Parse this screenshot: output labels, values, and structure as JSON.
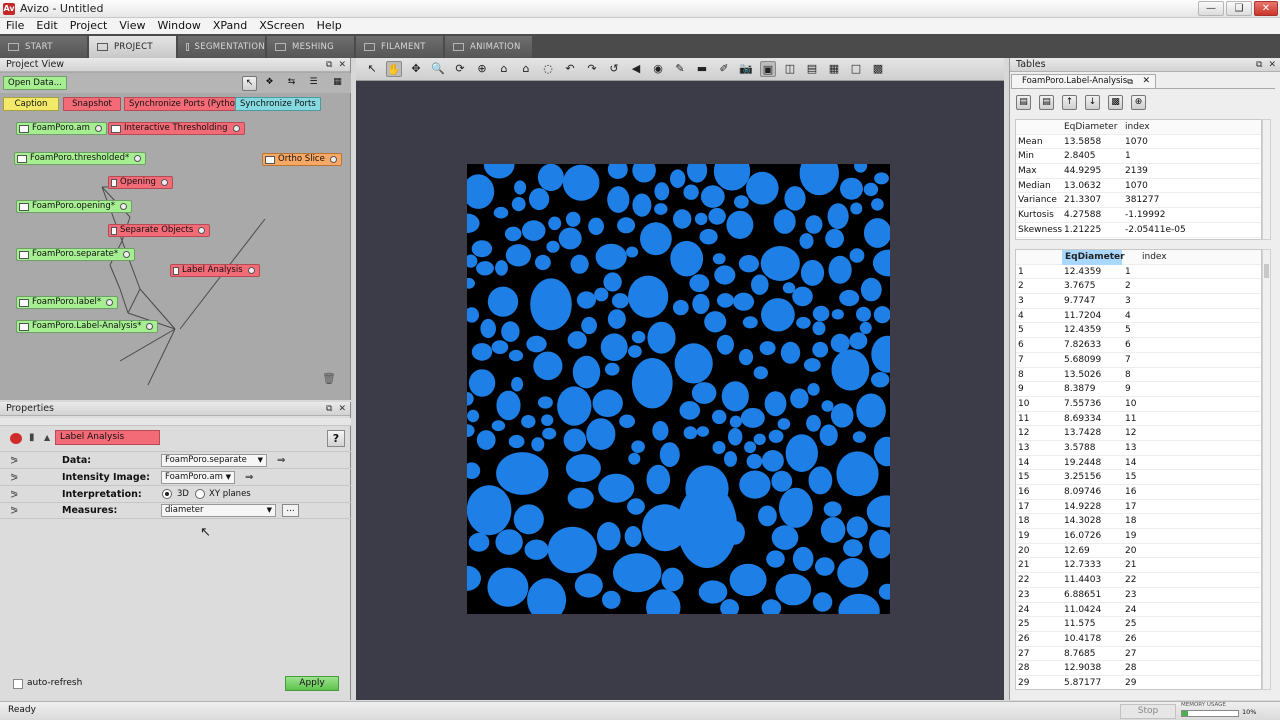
{
  "window": {
    "title": "Avizo - Untitled",
    "logo": "Av"
  },
  "menu": [
    "File",
    "Edit",
    "Project",
    "View",
    "Window",
    "XPand",
    "XScreen",
    "Help"
  ],
  "tabs": [
    {
      "label": "START",
      "active": false
    },
    {
      "label": "PROJECT",
      "active": true
    },
    {
      "label": "SEGMENTATION",
      "active": false
    },
    {
      "label": "MESHING",
      "active": false
    },
    {
      "label": "FILAMENT",
      "active": false
    },
    {
      "label": "ANIMATION",
      "active": false
    }
  ],
  "project_view": {
    "title": "Project View",
    "open_data": "Open Data...",
    "buttons": [
      "Caption",
      "Snapshot",
      "Synchronize Ports (Python)",
      "Synchronize Ports"
    ],
    "nodes": {
      "foamporo_am": "FoamPoro.am",
      "interactive_thresholding": "Interactive Thresholding",
      "foamporo_thresholded": "FoamPoro.thresholded*",
      "ortho_slice": "Ortho Slice",
      "opening": "Opening",
      "foamporo_opening": "FoamPoro.opening*",
      "separate_objects": "Separate Objects",
      "foamporo_separate": "FoamPoro.separate*",
      "label_analysis": "Label Analysis",
      "foamporo_label": "FoamPoro.label*",
      "foamporo_label_analysis": "FoamPoro.Label-Analysis*"
    }
  },
  "properties": {
    "title": "Properties",
    "module": "Label Analysis",
    "help": "?",
    "rows": {
      "data": {
        "label": "Data:",
        "value": "FoamPoro.separate"
      },
      "intensity": {
        "label": "Intensity Image:",
        "value": "FoamPoro.am"
      },
      "interpretation": {
        "label": "Interpretation:",
        "opt1": "3D",
        "opt2": "XY planes"
      },
      "measures": {
        "label": "Measures:",
        "value": "diameter",
        "more": "..."
      }
    },
    "auto_refresh": "auto-refresh",
    "apply": "Apply"
  },
  "tables": {
    "title": "Tables",
    "tab": "FoamPoro.Label-Analysis",
    "stats_headers": [
      "",
      "EqDiameter",
      "index"
    ],
    "stats": [
      [
        "Mean",
        "13.5858",
        "1070"
      ],
      [
        "Min",
        "2.8405",
        "1"
      ],
      [
        "Max",
        "44.9295",
        "2139"
      ],
      [
        "Median",
        "13.0632",
        "1070"
      ],
      [
        "Variance",
        "21.3307",
        "381277"
      ],
      [
        "Kurtosis",
        "4.27588",
        "-1.19992"
      ],
      [
        "Skewness",
        "1.21225",
        "-2.05411e-05"
      ]
    ],
    "data_headers": [
      "",
      "EqDiameter",
      "index"
    ],
    "rows": [
      [
        "1",
        "12.4359",
        "1"
      ],
      [
        "2",
        "3.7675",
        "2"
      ],
      [
        "3",
        "9.7747",
        "3"
      ],
      [
        "4",
        "11.7204",
        "4"
      ],
      [
        "5",
        "12.4359",
        "5"
      ],
      [
        "6",
        "7.82633",
        "6"
      ],
      [
        "7",
        "5.68099",
        "7"
      ],
      [
        "8",
        "13.5026",
        "8"
      ],
      [
        "9",
        "8.3879",
        "9"
      ],
      [
        "10",
        "7.55736",
        "10"
      ],
      [
        "11",
        "8.69334",
        "11"
      ],
      [
        "12",
        "13.7428",
        "12"
      ],
      [
        "13",
        "3.5788",
        "13"
      ],
      [
        "14",
        "19.2448",
        "14"
      ],
      [
        "15",
        "3.25156",
        "15"
      ],
      [
        "16",
        "8.09746",
        "16"
      ],
      [
        "17",
        "14.9228",
        "17"
      ],
      [
        "18",
        "14.3028",
        "18"
      ],
      [
        "19",
        "16.0726",
        "19"
      ],
      [
        "20",
        "12.69",
        "20"
      ],
      [
        "21",
        "12.7333",
        "21"
      ],
      [
        "22",
        "11.4403",
        "22"
      ],
      [
        "23",
        "6.88651",
        "23"
      ],
      [
        "24",
        "11.0424",
        "24"
      ],
      [
        "25",
        "11.575",
        "25"
      ],
      [
        "26",
        "10.4178",
        "26"
      ],
      [
        "27",
        "8.7685",
        "27"
      ],
      [
        "28",
        "12.9038",
        "28"
      ],
      [
        "29",
        "5.87177",
        "29"
      ]
    ]
  },
  "status": {
    "text": "Ready",
    "stop": "Stop",
    "memory_label": "MEMORY USAGE",
    "memory_pct": "10%",
    "memory_fraction": 0.1
  },
  "colors": {
    "pore": "#1e7fe6",
    "background": "#000000",
    "viewer": "#3c3c48",
    "data_node": "#a6ee92",
    "compute_node": "#f36b77",
    "display_node": "#f8a865"
  }
}
